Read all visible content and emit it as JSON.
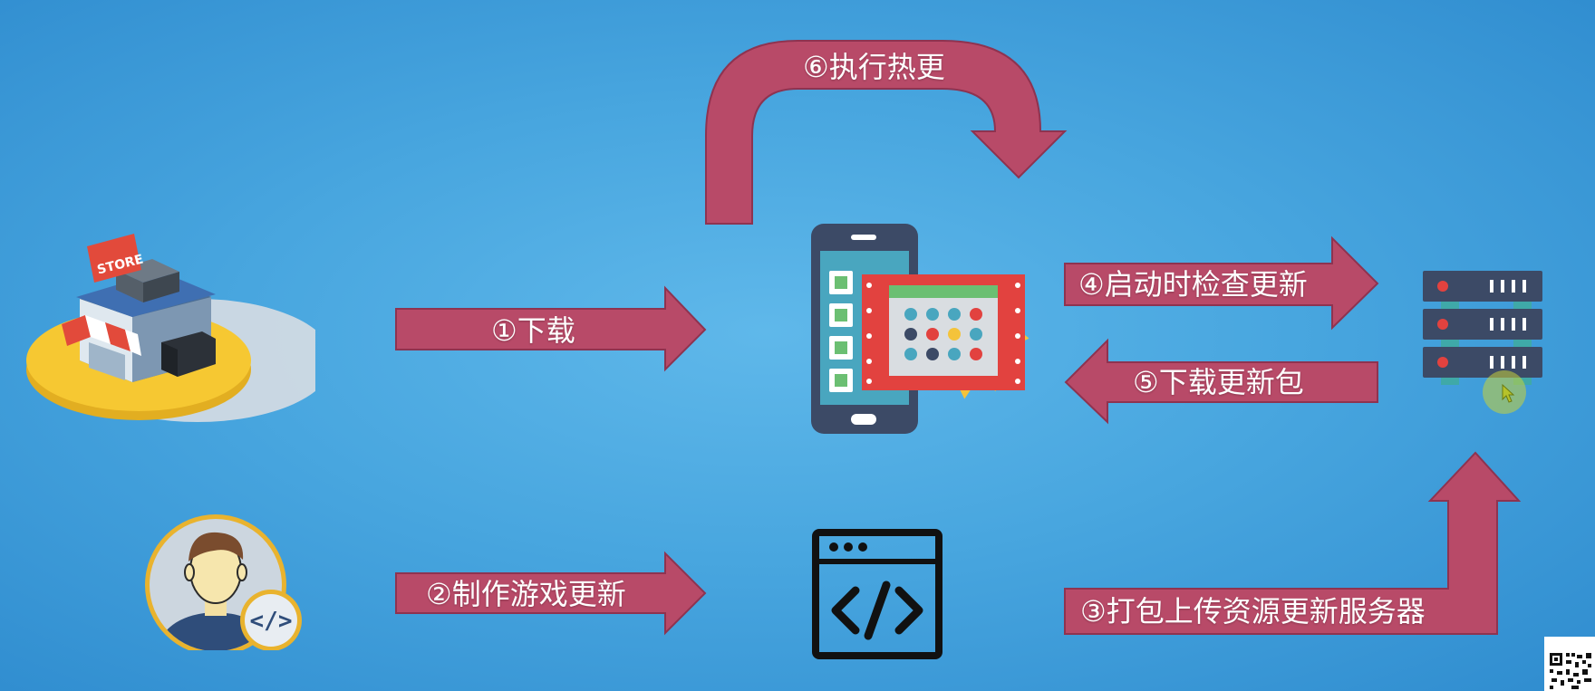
{
  "steps": {
    "download": "①下载",
    "make_update": "②制作游戏更新",
    "pack_upload": "③打包上传资源更新服务器",
    "check_update": "④启动时检查更新",
    "download_patch": "⑤下载更新包",
    "execute_hotfix": "⑥执行热更"
  },
  "store": {
    "sign": "STORE"
  },
  "dev_icon": {
    "glyph": "</>"
  },
  "colors": {
    "arrow": "#b84a68",
    "arrow_stroke": "#8e3350",
    "background": "#4aa8e0"
  },
  "icons": [
    "store-icon",
    "developer-icon",
    "phone-app-icon",
    "code-window-icon",
    "server-icon",
    "qr-code-icon"
  ]
}
